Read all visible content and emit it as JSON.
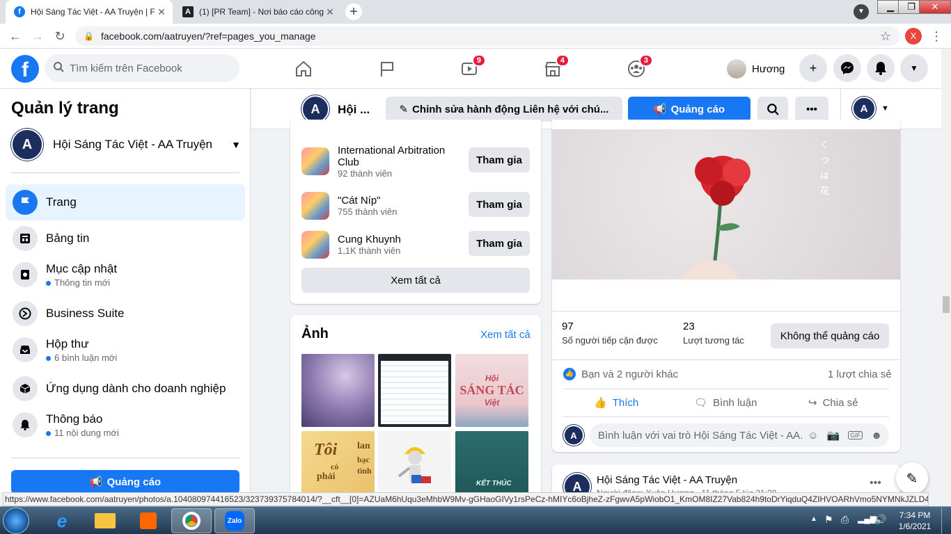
{
  "browser": {
    "tabs": [
      {
        "title": "Hội Sáng Tác Việt - AA Truyện | F",
        "favicon": "f"
      },
      {
        "title": "(1) [PR Team] - Nơi báo cáo công",
        "favicon": "A"
      }
    ],
    "url": "facebook.com/aatruyen/?ref=pages_you_manage",
    "profile_initial": "X"
  },
  "header": {
    "search_placeholder": "Tìm kiếm trên Facebook",
    "watch_badge": "9",
    "marketplace_badge": "4",
    "groups_badge": "3",
    "user_name": "Hương"
  },
  "sidebar": {
    "title": "Quản lý trang",
    "page_name": "Hội Sáng Tác Việt - AA Truyện",
    "items": [
      {
        "label": "Trang",
        "sub": ""
      },
      {
        "label": "Bảng tin",
        "sub": ""
      },
      {
        "label": "Mục cập nhật",
        "sub": "Thông tin mới"
      },
      {
        "label": "Business Suite",
        "sub": ""
      },
      {
        "label": "Hộp thư",
        "sub": "6 bình luận mới"
      },
      {
        "label": "Ứng dụng dành cho doanh nghiệp",
        "sub": ""
      },
      {
        "label": "Thông báo",
        "sub": "11 nội dung mới"
      }
    ],
    "promote_label": "Quảng cáo"
  },
  "page_header": {
    "page_short": "Hội ...",
    "edit_action": "Chỉnh sửa hành động Liên hệ với chú...",
    "promote": "Quảng cáo"
  },
  "groups": {
    "items": [
      {
        "name": "International Arbitration Club",
        "members": "92 thành viên"
      },
      {
        "name": "\"Cát Níp\"",
        "members": "755 thành viên"
      },
      {
        "name": "Cung Khuynh",
        "members": "1,1K thành viên"
      }
    ],
    "join_label": "Tham gia",
    "see_all": "Xem tất cả"
  },
  "photos": {
    "title": "Ảnh",
    "see_all": "Xem tất cả",
    "thumb_texts": [
      "Hội",
      "SÁNG TÁC",
      "Việt",
      "Tôi",
      "có",
      "phải",
      "lan",
      "bạc",
      "tình",
      "KẾT THÚC"
    ]
  },
  "post": {
    "reach_value": "97",
    "reach_label": "Số người tiếp cận được",
    "engage_value": "23",
    "engage_label": "Lượt tương tác",
    "cannot_promote": "Không thể quảng cáo",
    "reactions": "Bạn và 2 người khác",
    "shares": "1 lượt chia sẻ",
    "like": "Thích",
    "comment": "Bình luận",
    "share": "Chia sẻ",
    "comment_placeholder": "Bình luận với vai trò Hội Sáng Tác Việt - AA...",
    "gif_label": "GIF",
    "image_text": "く つ は 花"
  },
  "next_post": {
    "author": "Hội Sáng Tác Việt - AA Truyện",
    "meta": "Người đăng: Xuân Hương · 11 tháng 5 lúc 21:38"
  },
  "status_url": "https://www.facebook.com/aatruyen/photos/a.104080974416523/323739375784014/?__cft__[0]=AZUaM6hUqu3eMhbW9Mv-gGHaoGIVy1rsPeCz-hMIYc6oBjheZ-zFgwvA5pWiobO1_KmOM8IZ27Vab824h9toDrYiqduQ4ZIHVOARhVmo5NYMNkJZLD4D...",
  "taskbar": {
    "time": "7:34 PM",
    "date": "1/6/2021",
    "zalo": "Zalo"
  },
  "colors": {
    "fb_blue": "#1877f2",
    "badge_red": "#e41e3f"
  }
}
